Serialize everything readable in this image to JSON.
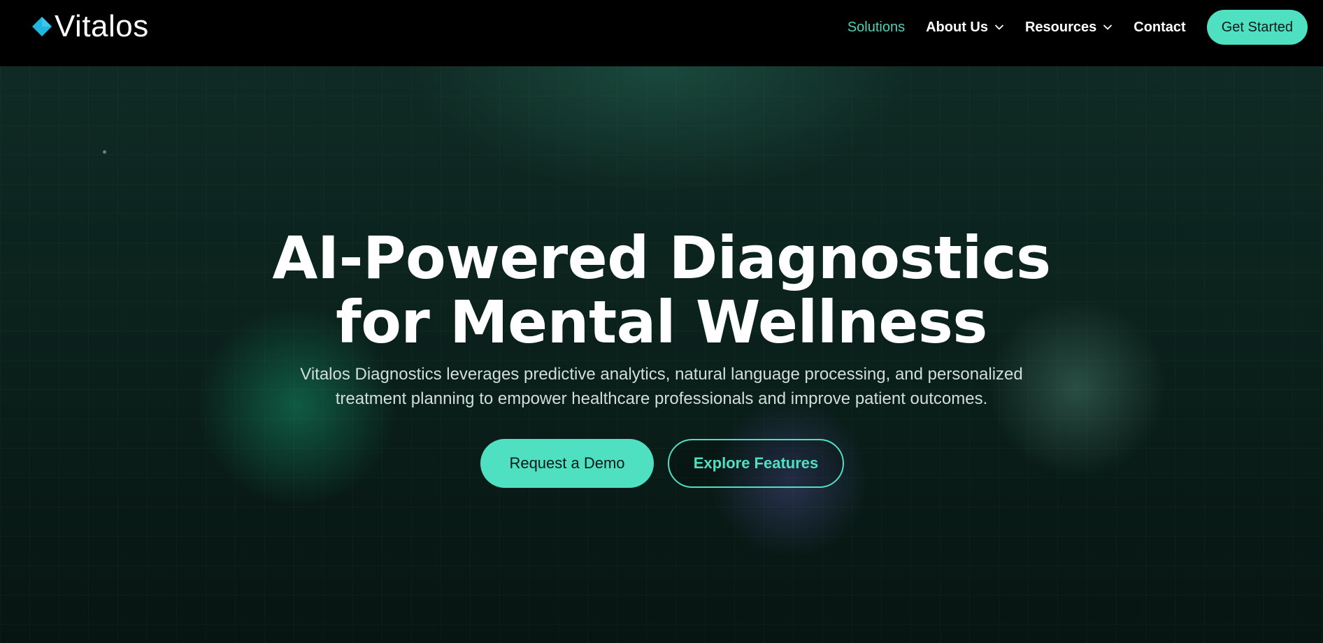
{
  "brand": {
    "name": "Vitalos",
    "logo_icon": "diamond-icon",
    "logo_color": "#1fb6e0"
  },
  "nav": {
    "items": [
      {
        "label": "Solutions",
        "active": true
      },
      {
        "label": "About Us",
        "has_dropdown": true
      },
      {
        "label": "Resources",
        "has_dropdown": true
      },
      {
        "label": "Contact"
      }
    ],
    "cta_label": "Get Started"
  },
  "hero": {
    "headline_line1": "AI-Powered Diagnostics",
    "headline_line2": "for Mental Wellness",
    "subhead_line1": "Vitalos Diagnostics leverages predictive analytics, natural language processing, and personalized",
    "subhead_line2": "treatment planning to empower healthcare professionals and improve patient outcomes.",
    "primary_button": "Request a Demo",
    "secondary_button": "Explore Features"
  },
  "colors": {
    "accent": "#4fe0c2",
    "active_nav": "#4fd1b7",
    "background": "#0b211c"
  }
}
